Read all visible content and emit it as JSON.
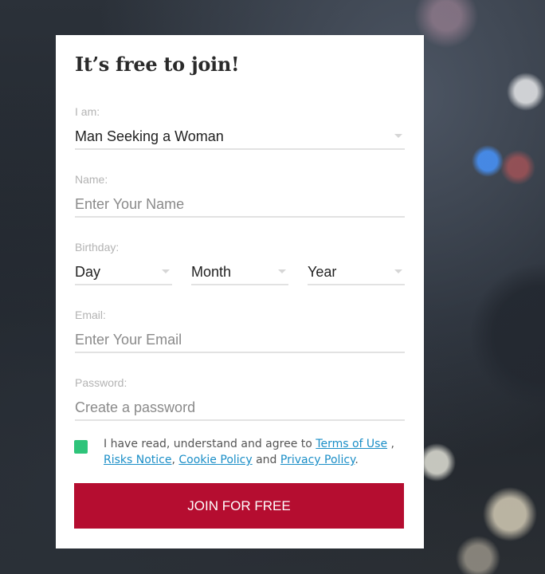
{
  "form": {
    "title": "It’s free to join!",
    "seeking": {
      "label": "I am:",
      "value": "Man Seeking a Woman"
    },
    "name": {
      "label": "Name:",
      "placeholder": "Enter Your Name"
    },
    "birthday": {
      "label": "Birthday:",
      "day": "Day",
      "month": "Month",
      "year": "Year"
    },
    "email": {
      "label": "Email:",
      "placeholder": "Enter Your Email"
    },
    "password": {
      "label": "Password:",
      "placeholder": "Create a password"
    },
    "agreement": {
      "checked": true,
      "text_before": "I have read, understand and agree to ",
      "terms": "Terms of Use",
      "sep1": " , ",
      "risks": "Risks Notice",
      "sep2": ", ",
      "cookie": "Cookie Policy",
      "sep3": " and ",
      "privacy": "Privacy Policy",
      "end": "."
    },
    "join_button": "JOIN FOR FREE"
  },
  "colors": {
    "checkbox": "#2ec47a",
    "join_button": "#b50d30",
    "link": "#1a8ec7"
  }
}
